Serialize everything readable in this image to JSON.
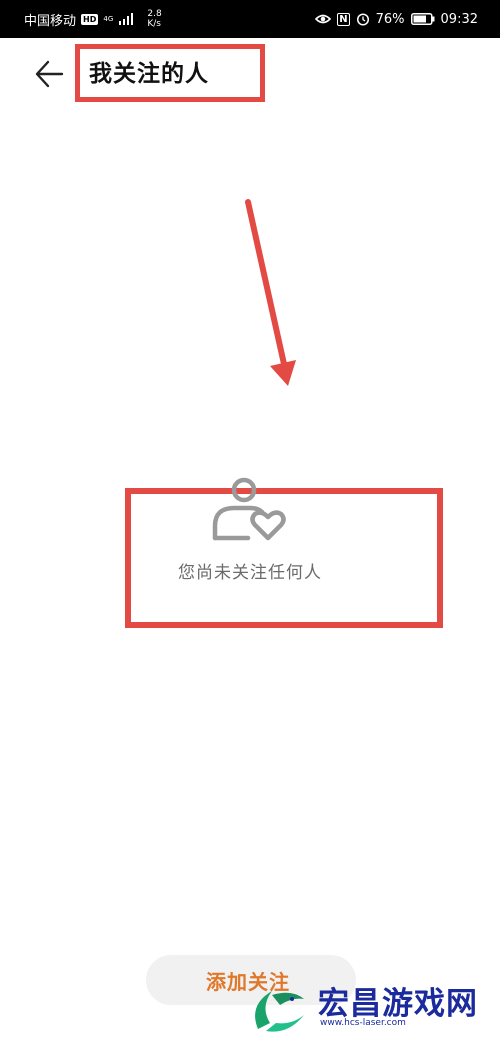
{
  "status_bar": {
    "carrier": "中国移动",
    "hd": "HD",
    "network": "4G",
    "speed_value": "2.8",
    "speed_unit": "K/s",
    "nfc": "N",
    "battery": "76%",
    "time": "09:32"
  },
  "header": {
    "title": "我关注的人"
  },
  "empty_state": {
    "message": "您尚未关注任何人"
  },
  "footer": {
    "add_label": "添加关注"
  },
  "watermark": {
    "title": "宏昌游戏网",
    "url": "www.hcs-laser.com"
  },
  "colors": {
    "annotation": "#e34a44",
    "accent": "#e0782b",
    "icon": "#9a9a9a"
  }
}
